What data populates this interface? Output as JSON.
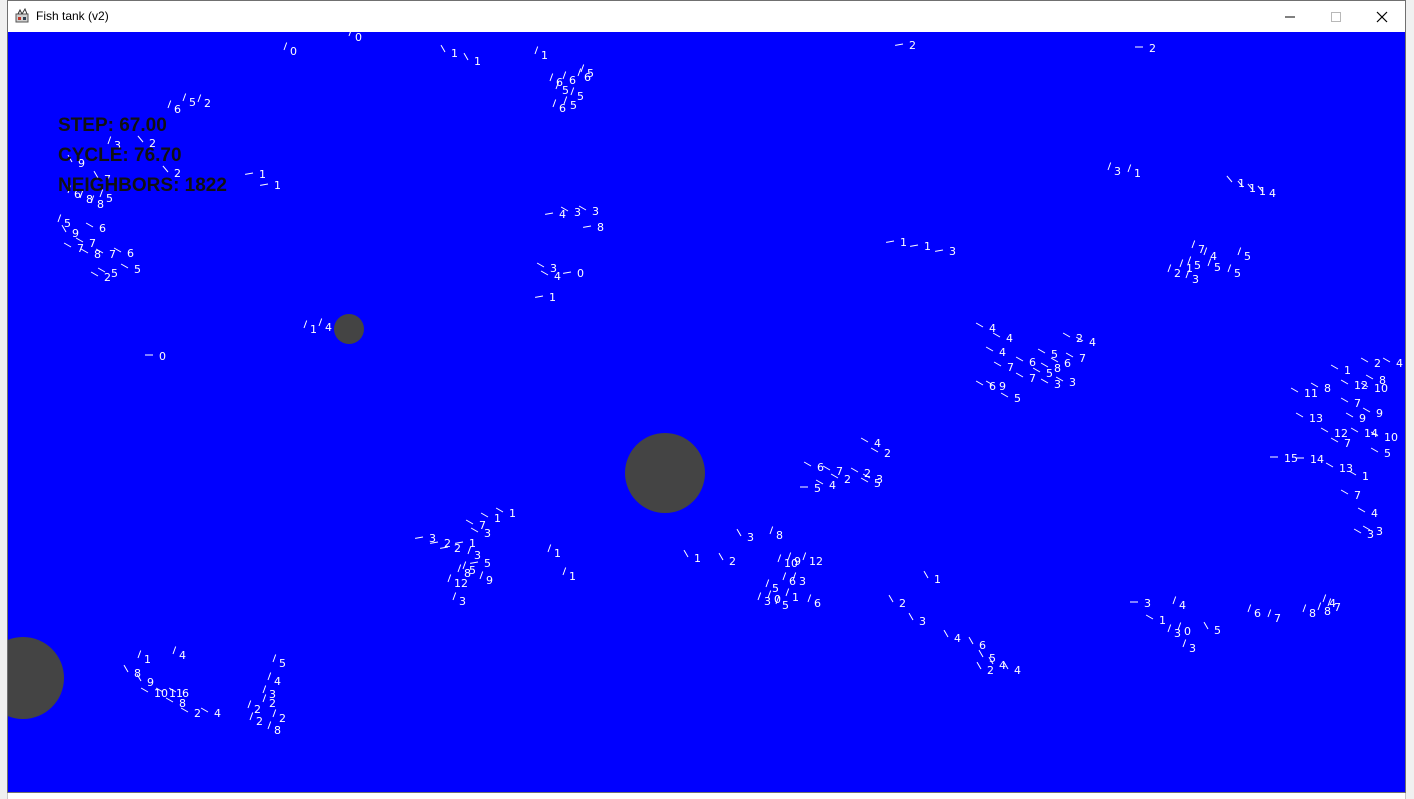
{
  "window": {
    "title": "Fish tank (v2)",
    "controls": {
      "minimize": "minimize-icon",
      "maximize": "maximize-icon",
      "close": "close-icon"
    }
  },
  "colors": {
    "tank_background": "#0000ff",
    "obstacle": "#444444",
    "fish": "#ffffff",
    "hud_text": "#111111"
  },
  "hud": {
    "step": "STEP: 67.00",
    "cycle": "CYCLE: 76.70",
    "neighbors": "NEIGHBORS: 1822"
  },
  "obstacles": [
    "obstacle-1",
    "obstacle-2",
    "obstacle-3"
  ],
  "fish_labels": [
    "0",
    "0",
    "1",
    "1",
    "1",
    "2",
    "2",
    "0",
    "1",
    "4",
    "5",
    "6",
    "6",
    "6",
    "5",
    "5",
    "5",
    "6",
    "5",
    "2",
    "6",
    "3",
    "2",
    "2",
    "1",
    "1",
    "9",
    "7",
    "6",
    "8",
    "8",
    "5",
    "5",
    "9",
    "6",
    "7",
    "7",
    "8",
    "7",
    "6",
    "5",
    "2",
    "5",
    "0",
    "1",
    "1",
    "3",
    "4",
    "3",
    "3",
    "8",
    "3",
    "4",
    "1",
    "3",
    "1",
    "1",
    "1",
    "1",
    "4",
    "4",
    "4",
    "4",
    "2",
    "4",
    "5",
    "6",
    "7",
    "6",
    "5",
    "8",
    "7",
    "6",
    "9",
    "7",
    "3",
    "3",
    "5",
    "7",
    "4",
    "5",
    "2",
    "1",
    "5",
    "5",
    "5",
    "3",
    "1",
    "2",
    "4",
    "10",
    "9",
    "14",
    "12",
    "13",
    "11",
    "8",
    "7",
    "10",
    "12",
    "8",
    "9",
    "7",
    "15",
    "14",
    "13",
    "1",
    "5",
    "7",
    "4",
    "3",
    "3",
    "4",
    "2",
    "2",
    "3",
    "2",
    "4",
    "5",
    "6",
    "7",
    "5",
    "1",
    "1",
    "7",
    "3",
    "3",
    "2",
    "2",
    "1",
    "3",
    "5",
    "8",
    "12",
    "9",
    "5",
    "3",
    "1",
    "1",
    "1",
    "2",
    "3",
    "8",
    "9",
    "12",
    "10",
    "6",
    "5",
    "3",
    "0",
    "1",
    "3",
    "5",
    "6",
    "2",
    "1",
    "3",
    "4",
    "6",
    "5",
    "4",
    "2",
    "4",
    "3",
    "1",
    "4",
    "3",
    "0",
    "3",
    "5",
    "6",
    "7",
    "8",
    "8",
    "7",
    "4",
    "1",
    "4",
    "8",
    "9",
    "10",
    "11",
    "6",
    "8",
    "2",
    "4",
    "5",
    "4",
    "3",
    "2",
    "2",
    "2",
    "2",
    "8"
  ]
}
